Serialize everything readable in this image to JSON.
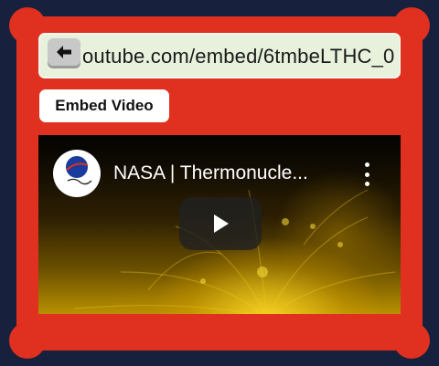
{
  "url_bar": {
    "value": "outube.com/embed/6tmbeLTHC_0"
  },
  "toolbar": {
    "back_icon": "arrow-left-icon",
    "embed_label": "Embed Video"
  },
  "video": {
    "channel_avatar_text": "NASA",
    "channel_avatar_signature": "Goddard",
    "title": "NASA | Thermonucle...",
    "more_icon": "more-vertical-icon",
    "play_icon": "play-icon"
  },
  "colors": {
    "background": "#17213d",
    "frame": "#e0301f",
    "url_bar": "#e7f1dc",
    "button": "#ffffff",
    "play_button": "#212121"
  }
}
